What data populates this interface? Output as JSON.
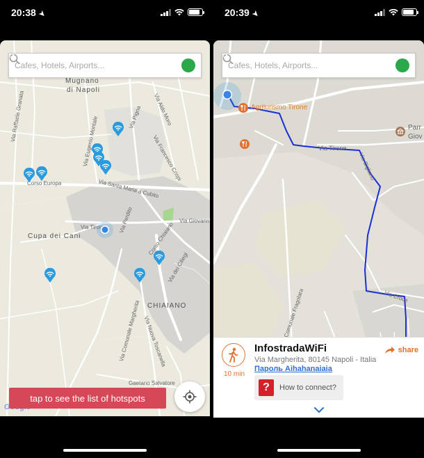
{
  "left_screen": {
    "status": {
      "time": "20:38"
    },
    "search": {
      "placeholder": "Cafes, Hotels, Airports..."
    },
    "map_labels": {
      "mugnano": "Mugnano",
      "di_napoli": "di Napoli",
      "corso_europa": "Corso Europa",
      "via_santa_maria": "Via Santa Maria a Cubito",
      "via_tirone": "Via Tirone",
      "via_giovanni": "Via Giovann",
      "cupa_dei_cani": "Cupa dei Cani",
      "via_perdito": "Via Perdito",
      "corso_chiaiano": "Corso Chiaiano",
      "via_dei_ciliegi": "Via dei Ciliegi",
      "chiaiano": "CHIAIANO",
      "via_comunale_margherita": "Via Comunale Margherita",
      "via_nuova_toscanella": "Via Nuova Toscanella",
      "via_raffaele_granata": "Via Raffaele Granata",
      "via_eugenio_montale": "Via Eugenio Montale",
      "via_aldo_moro": "Via Aldo Moro",
      "via_francesco_crispi": "Via Francesco Crispi",
      "via_pigna": "Via Pigna",
      "gaetano_salvatore": "Gaetano Salvatore"
    },
    "hotspot_banner": "tap to see the list of hotspots",
    "google_logo": "Google"
  },
  "right_screen": {
    "status": {
      "time": "20:39"
    },
    "search": {
      "placeholder": "Cafes, Hotels, Airports..."
    },
    "map_labels": {
      "agriturismo": "Agriturismo Tirone",
      "via_tirone": "Via Tirone",
      "parr": "Parr",
      "giov": "Giov",
      "via_croce": "Via Croce",
      "comunale_fragolara": "Comunale Fragolara",
      "via_cigliano": "Via Cigliano"
    },
    "hotspot": {
      "name": "InfostradaWiFi",
      "address": "Via Margherita, 80145 Napoli - Italia",
      "password": "Пароль Aihahanaiaia",
      "walk_time": "10 min",
      "share_label": "share",
      "connect_label": "How to connect?"
    }
  },
  "colors": {
    "wifi_pin": "#2b9be0",
    "route": "#1a2fd6",
    "banner": "#d64857",
    "accent_orange": "#e0712f",
    "download_green": "#2aa84a"
  },
  "icons": [
    "location-arrow-icon",
    "signal-icon",
    "wifi-icon",
    "battery-icon",
    "search-icon",
    "download-icon",
    "wifi-pin-icon",
    "user-location-icon",
    "crosshair-icon",
    "walk-icon",
    "share-icon",
    "question-icon",
    "chevron-down-icon",
    "restaurant-icon",
    "landmark-icon"
  ]
}
